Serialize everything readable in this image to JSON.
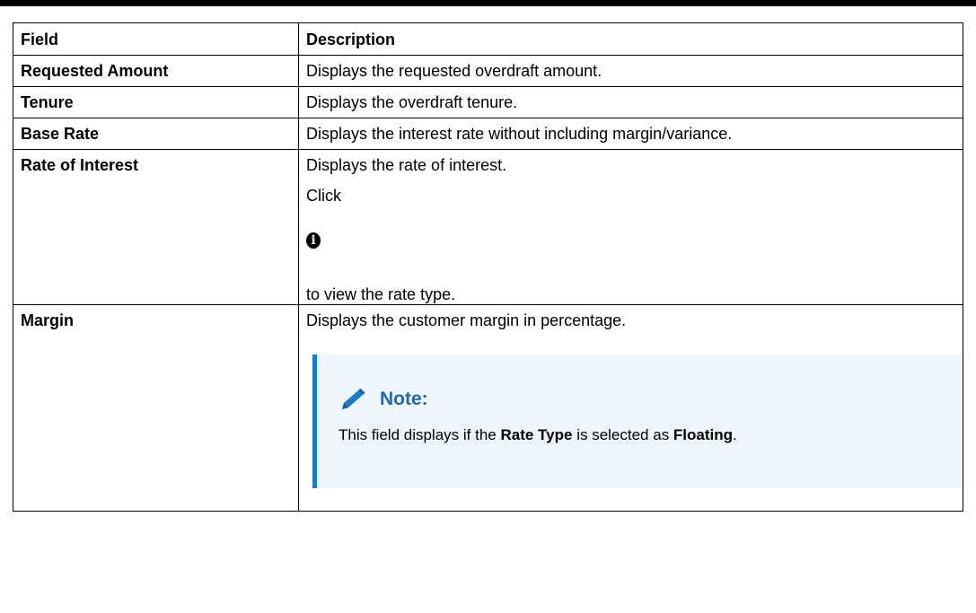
{
  "table": {
    "headers": [
      "Field",
      "Description"
    ],
    "rows": [
      {
        "field": "Requested Amount",
        "description": "Displays the requested overdraft amount."
      },
      {
        "field": "Tenure",
        "description": "Displays the overdraft tenure."
      },
      {
        "field": "Base Rate",
        "description": "Displays the interest rate without including margin/variance."
      },
      {
        "field": "Rate of Interest",
        "description": "Displays the rate of interest.",
        "click_text": "Click",
        "after_icon_text": "to view the rate type.",
        "icon": "info-icon"
      },
      {
        "field": "Margin",
        "description": "Displays the customer margin in percentage."
      }
    ]
  },
  "note": {
    "icon": "pencil-icon",
    "title": "Note:",
    "text_part1": "This field displays if the ",
    "bold1": "Rate Type",
    "text_part2": " is selected as ",
    "bold2": "Floating",
    "text_part3": ".",
    "accent_color": "#1e7bc8",
    "title_color": "#2468a8",
    "background_color": "#eef5fb"
  }
}
